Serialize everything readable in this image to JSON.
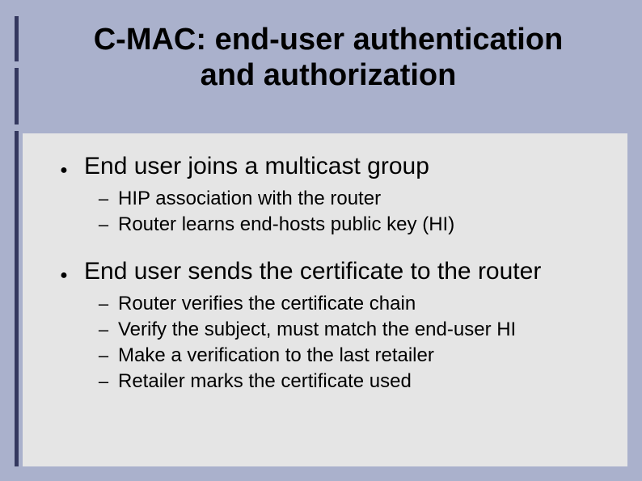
{
  "title": {
    "line1": "C-MAC: end-user authentication",
    "line2": "and authorization"
  },
  "bullets": [
    {
      "text": "End user joins a multicast group",
      "subs": [
        "HIP association with the router",
        "Router learns end-hosts public key (HI)"
      ]
    },
    {
      "text": "End user sends the certificate to the router",
      "subs": [
        "Router verifies the certificate chain",
        "Verify the subject, must match the end-user HI",
        "Make a verification to the last retailer",
        "Retailer marks the certificate used"
      ]
    }
  ]
}
